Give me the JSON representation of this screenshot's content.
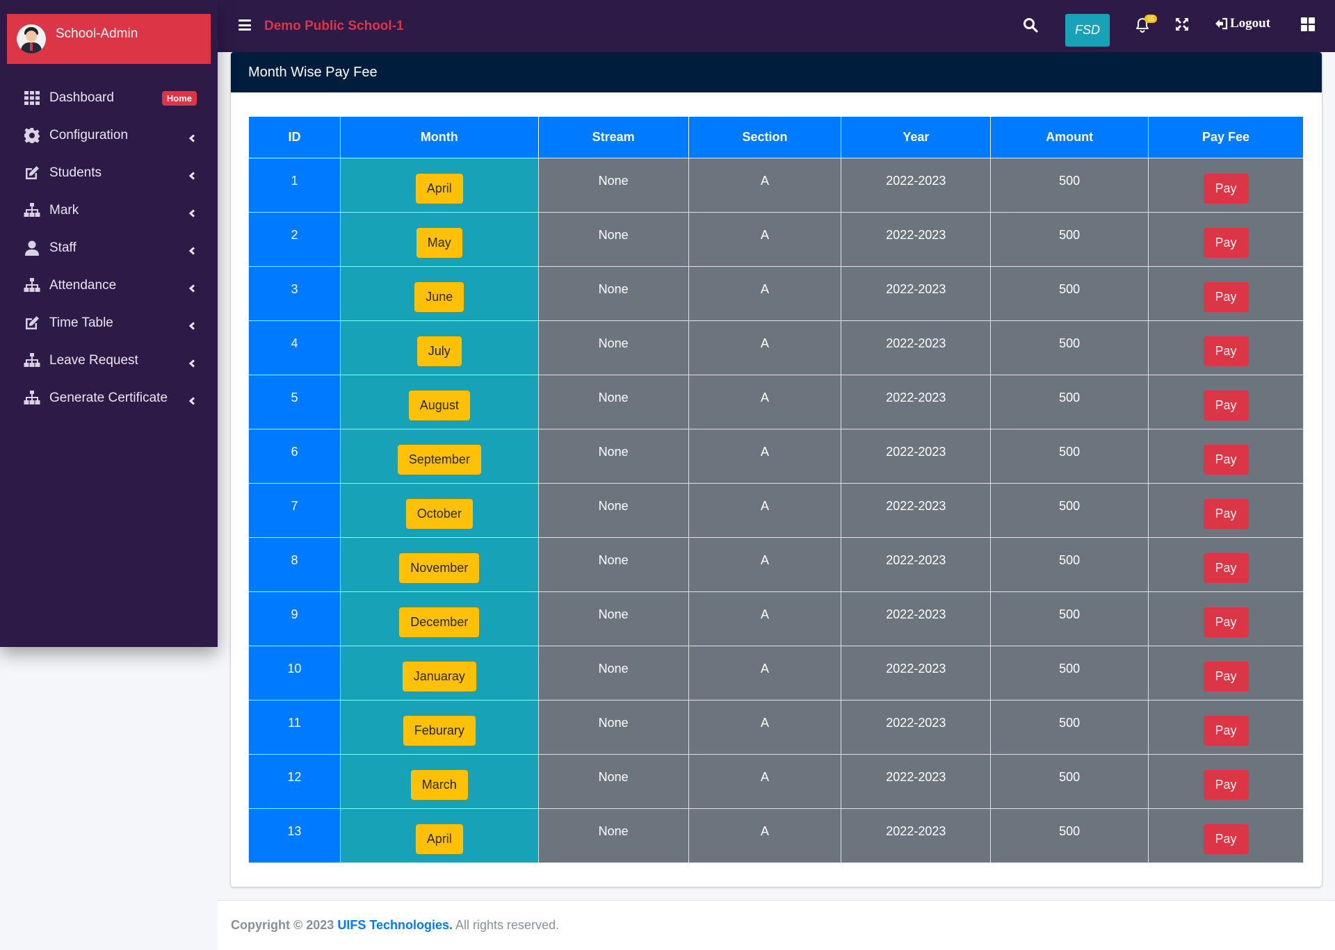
{
  "sidebar": {
    "brand_title": "School-Admin",
    "items": [
      {
        "label": "Dashboard",
        "icon": "grid-icon",
        "badge": "Home"
      },
      {
        "label": "Configuration",
        "icon": "gear-icon"
      },
      {
        "label": "Students",
        "icon": "edit-icon"
      },
      {
        "label": "Mark",
        "icon": "sitemap-icon"
      },
      {
        "label": "Staff",
        "icon": "user-icon"
      },
      {
        "label": "Attendance",
        "icon": "sitemap-icon"
      },
      {
        "label": "Time Table",
        "icon": "edit-icon"
      },
      {
        "label": "Leave Request",
        "icon": "sitemap-icon"
      },
      {
        "label": "Generate Certificate",
        "icon": "sitemap-icon"
      }
    ]
  },
  "header": {
    "school_name": "Demo Public School-1",
    "fsd_label": "FSD",
    "notification_count": "15",
    "logout_label": "Logout"
  },
  "card": {
    "title": "Month Wise Pay Fee"
  },
  "table": {
    "columns": [
      "ID",
      "Month",
      "Stream",
      "Section",
      "Year",
      "Amount",
      "Pay Fee"
    ],
    "rows": [
      {
        "id": "1",
        "month": "April",
        "stream": "None",
        "section": "A",
        "year": "2022-2023",
        "amount": "500",
        "action": "Pay"
      },
      {
        "id": "2",
        "month": "May",
        "stream": "None",
        "section": "A",
        "year": "2022-2023",
        "amount": "500",
        "action": "Pay"
      },
      {
        "id": "3",
        "month": "June",
        "stream": "None",
        "section": "A",
        "year": "2022-2023",
        "amount": "500",
        "action": "Pay"
      },
      {
        "id": "4",
        "month": "July",
        "stream": "None",
        "section": "A",
        "year": "2022-2023",
        "amount": "500",
        "action": "Pay"
      },
      {
        "id": "5",
        "month": "August",
        "stream": "None",
        "section": "A",
        "year": "2022-2023",
        "amount": "500",
        "action": "Pay"
      },
      {
        "id": "6",
        "month": "September",
        "stream": "None",
        "section": "A",
        "year": "2022-2023",
        "amount": "500",
        "action": "Pay"
      },
      {
        "id": "7",
        "month": "October",
        "stream": "None",
        "section": "A",
        "year": "2022-2023",
        "amount": "500",
        "action": "Pay"
      },
      {
        "id": "8",
        "month": "November",
        "stream": "None",
        "section": "A",
        "year": "2022-2023",
        "amount": "500",
        "action": "Pay"
      },
      {
        "id": "9",
        "month": "December",
        "stream": "None",
        "section": "A",
        "year": "2022-2023",
        "amount": "500",
        "action": "Pay"
      },
      {
        "id": "10",
        "month": "Januaray",
        "stream": "None",
        "section": "A",
        "year": "2022-2023",
        "amount": "500",
        "action": "Pay"
      },
      {
        "id": "11",
        "month": "Feburary",
        "stream": "None",
        "section": "A",
        "year": "2022-2023",
        "amount": "500",
        "action": "Pay"
      },
      {
        "id": "12",
        "month": "March",
        "stream": "None",
        "section": "A",
        "year": "2022-2023",
        "amount": "500",
        "action": "Pay"
      },
      {
        "id": "13",
        "month": "April",
        "stream": "None",
        "section": "A",
        "year": "2022-2023",
        "amount": "500",
        "action": "Pay"
      }
    ]
  },
  "footer": {
    "copyright": "Copyright © 2023",
    "company": "UIFS Technologies.",
    "rights": "All rights reserved."
  },
  "colors": {
    "sidebar_bg": "#2e1a47",
    "brand_red": "#dc3545",
    "primary_blue": "#007bff",
    "teal": "#17a2b8",
    "grey": "#6c757d",
    "yellow": "#ffc107",
    "card_header": "#001d3d"
  }
}
